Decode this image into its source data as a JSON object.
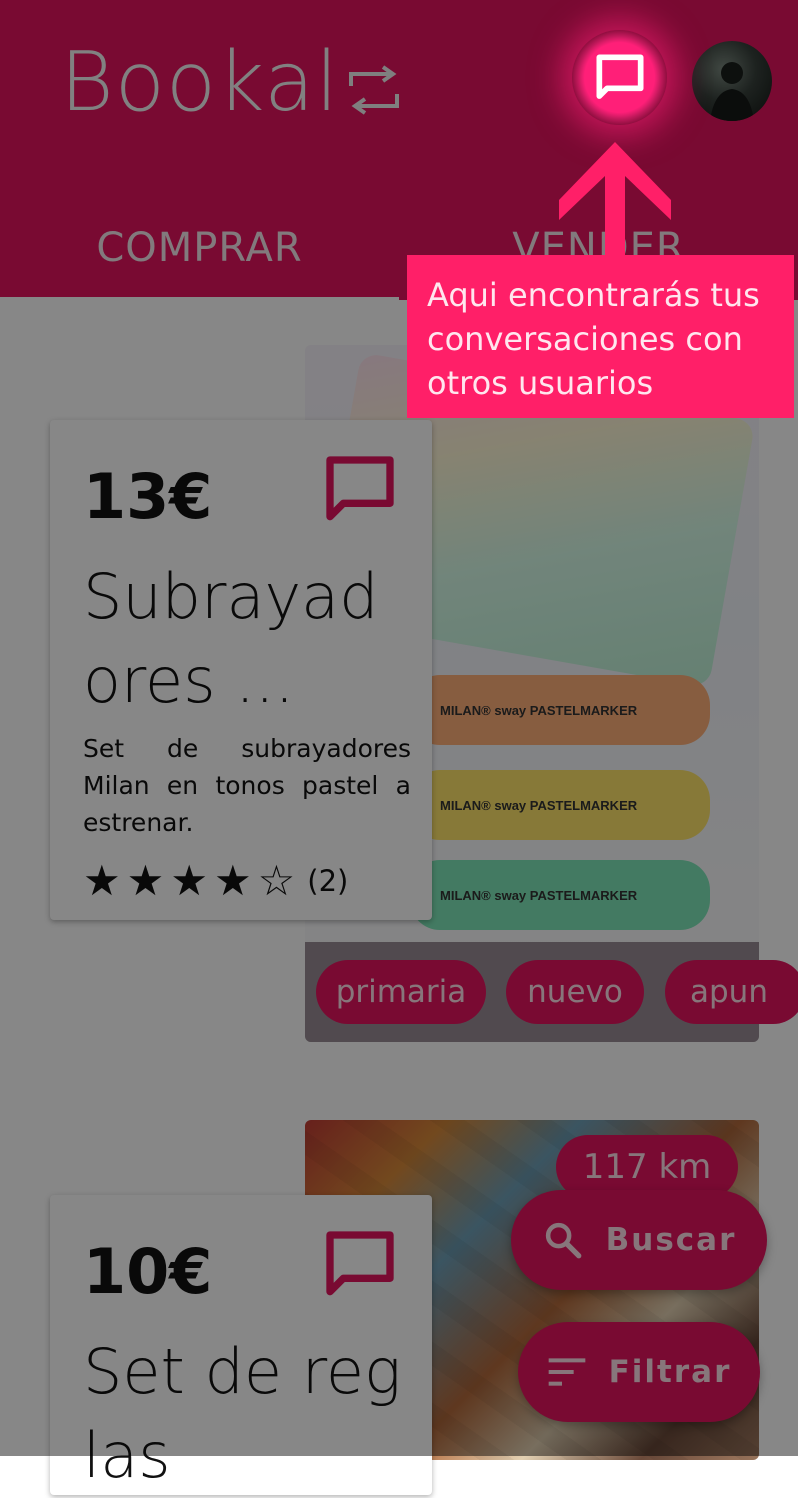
{
  "app": {
    "logo_text": "Bookal",
    "theme_color": "#e4135f"
  },
  "header": {
    "chat_icon": "chat-bubble-icon",
    "avatar": "user-avatar"
  },
  "tabs": [
    {
      "label": "COMPRAR",
      "selected": true
    },
    {
      "label": "VENDER",
      "selected": false
    }
  ],
  "products": [
    {
      "price": "13€",
      "title": "Subrayadores ...",
      "description": "Set de subrayadores Milan en tonos pastel a estrenar.",
      "rating": {
        "stars_filled": 4,
        "stars_total": 5,
        "count": "(2)"
      },
      "tags": [
        "primaria",
        "nuevo",
        "apun"
      ],
      "image_labels": [
        "MILAN® sway PASTELMARKER",
        "MILAN® sway PASTELMARKER",
        "MILAN® sway PASTELMARKER"
      ]
    },
    {
      "price": "10€",
      "title": "Set de reglas",
      "distance": "117 km"
    }
  ],
  "fabs": {
    "search_label": "Buscar",
    "filter_label": "Filtrar"
  },
  "tutorial": {
    "message": "Aqui encontrarás tus conversaciones con otros usuarios"
  }
}
